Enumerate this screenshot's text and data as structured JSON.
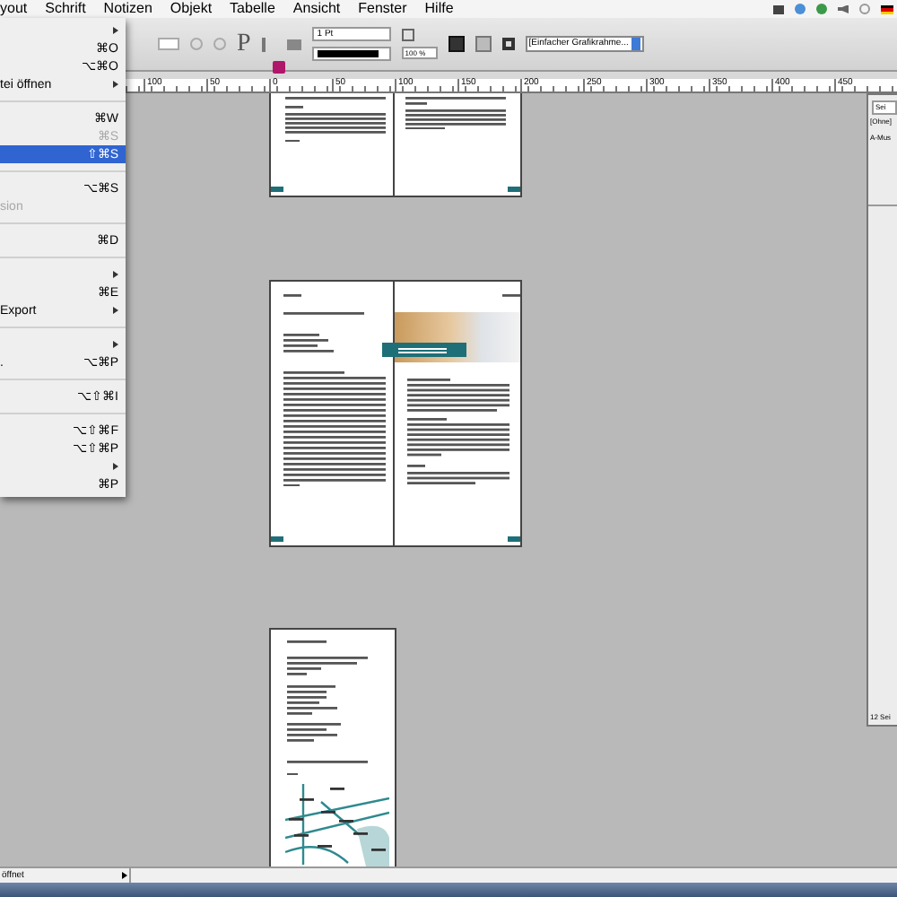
{
  "menubar": {
    "items": [
      "yout",
      "Schrift",
      "Notizen",
      "Objekt",
      "Tabelle",
      "Ansicht",
      "Fenster",
      "Hilfe"
    ]
  },
  "toolbar": {
    "type_glyph": "P",
    "stroke_weight": "1 Pt",
    "zoom": "100 %",
    "frame_style": "[Einfacher Grafikrahme..."
  },
  "ruler": {
    "labels": [
      "100",
      "50",
      "0",
      "50",
      "100",
      "150",
      "200",
      "250",
      "300",
      "350",
      "400",
      "450"
    ]
  },
  "file_menu": {
    "items": [
      {
        "kind": "item",
        "submenu": true,
        "disabled": false,
        "selected": false
      },
      {
        "kind": "item",
        "shortcut": "⌘O",
        "submenu": false,
        "disabled": false,
        "selected": false
      },
      {
        "kind": "item",
        "shortcut": "⌥⌘O",
        "submenu": false,
        "disabled": false,
        "selected": false
      },
      {
        "kind": "item",
        "label": "tei öffnen",
        "submenu": true,
        "disabled": false,
        "selected": false
      },
      {
        "kind": "separator"
      },
      {
        "kind": "item",
        "shortcut": "⌘W",
        "submenu": false,
        "disabled": false,
        "selected": false
      },
      {
        "kind": "item",
        "shortcut": "⌘S",
        "submenu": false,
        "disabled": true,
        "selected": false
      },
      {
        "kind": "item",
        "shortcut": "⇧⌘S",
        "submenu": false,
        "disabled": false,
        "selected": true
      },
      {
        "kind": "separator"
      },
      {
        "kind": "item",
        "shortcut": "⌥⌘S",
        "submenu": false,
        "disabled": false,
        "selected": false
      },
      {
        "kind": "item",
        "label": "sion",
        "submenu": false,
        "disabled": true,
        "selected": false
      },
      {
        "kind": "separator"
      },
      {
        "kind": "item",
        "shortcut": "⌘D",
        "submenu": false,
        "disabled": false,
        "selected": false
      },
      {
        "kind": "separator"
      },
      {
        "kind": "item",
        "submenu": true,
        "disabled": false,
        "selected": false
      },
      {
        "kind": "item",
        "shortcut": "⌘E",
        "submenu": false,
        "disabled": false,
        "selected": false
      },
      {
        "kind": "item",
        "label": "Export",
        "submenu": true,
        "disabled": false,
        "selected": false
      },
      {
        "kind": "separator"
      },
      {
        "kind": "item",
        "submenu": true,
        "disabled": false,
        "selected": false
      },
      {
        "kind": "item",
        "label": ".",
        "shortcut": "⌥⌘P",
        "submenu": false,
        "disabled": false,
        "selected": false
      },
      {
        "kind": "separator"
      },
      {
        "kind": "item",
        "shortcut": "⌥⇧⌘I",
        "submenu": false,
        "disabled": false,
        "selected": false
      },
      {
        "kind": "separator"
      },
      {
        "kind": "item",
        "shortcut": "⌥⇧⌘F",
        "submenu": false,
        "disabled": false,
        "selected": false
      },
      {
        "kind": "item",
        "shortcut": "⌥⇧⌘P",
        "submenu": false,
        "disabled": false,
        "selected": false
      },
      {
        "kind": "item",
        "submenu": true,
        "disabled": false,
        "selected": false
      },
      {
        "kind": "item",
        "shortcut": "⌘P",
        "submenu": false,
        "disabled": false,
        "selected": false
      }
    ]
  },
  "pages_panel": {
    "tab": "Sei",
    "none_master": "[Ohne]",
    "master": "A-Mus",
    "footer": "12 Sei"
  },
  "status_bar": {
    "text": "öffnet"
  }
}
